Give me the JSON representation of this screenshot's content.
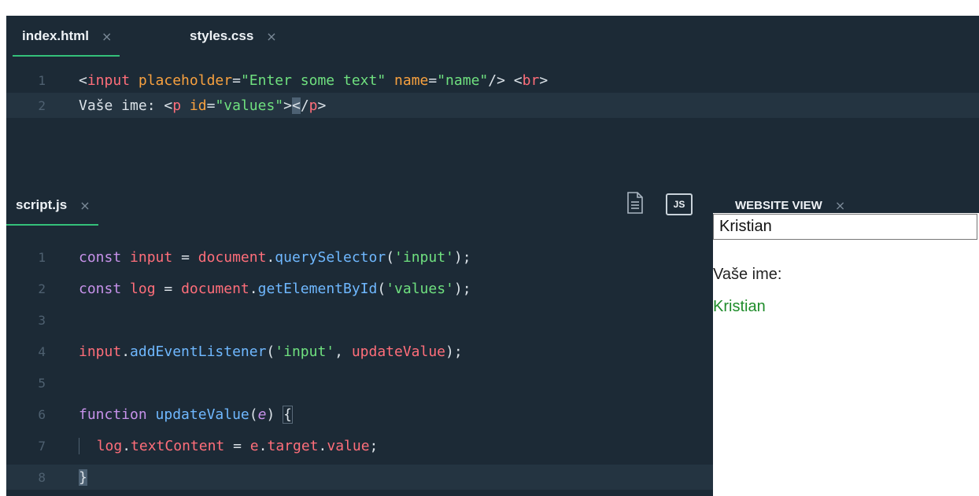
{
  "top_tabs": [
    {
      "label": "index.html",
      "close": "×"
    },
    {
      "label": "styles.css",
      "close": "×"
    }
  ],
  "html_editor": {
    "line_numbers": [
      "1",
      "2"
    ]
  },
  "script_tab": {
    "label": "script.js",
    "close": "×"
  },
  "toolbar": {
    "js_badge": "JS",
    "file_icon": "document-icon"
  },
  "preview_tab": {
    "label": "WEBSITE VIEW",
    "close": "×"
  },
  "js_editor": {
    "line_numbers": [
      "1",
      "2",
      "3",
      "4",
      "5",
      "6",
      "7",
      "8"
    ]
  },
  "preview": {
    "input_value": "Kristian",
    "input_placeholder": "Enter some text",
    "label_text": "Vaše ime:",
    "output_value": "Kristian"
  },
  "colors": {
    "editor_bg": "#1c2a36",
    "active_tab_underline": "#34c07a",
    "tag": "#ff6e7a",
    "attribute": "#f8a13f",
    "string": "#6fe07f",
    "keyword": "#c792ea",
    "function": "#6fb8ff",
    "output_text": "#1e8c2a"
  }
}
